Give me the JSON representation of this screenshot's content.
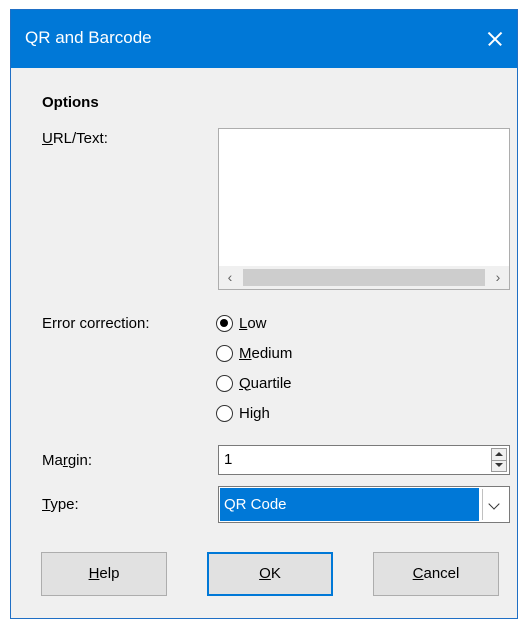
{
  "dialog": {
    "title": "QR and Barcode",
    "options_heading": "Options",
    "url_text": {
      "label_mnemonic": "U",
      "label_rest": "RL/Text:",
      "value": "",
      "scroll_left": "‹",
      "scroll_right": "›"
    },
    "error_correction": {
      "label": "Error correction:",
      "selected": "Low",
      "options": [
        {
          "mnemonic": "L",
          "rest": "ow"
        },
        {
          "mnemonic": "M",
          "rest": "edium"
        },
        {
          "mnemonic": "Q",
          "rest": "uartile"
        },
        {
          "pre": "Hi",
          "mnemonic": "g",
          "rest": "h"
        }
      ]
    },
    "margin": {
      "pre": "Ma",
      "mnemonic": "r",
      "rest": "gin:",
      "value": "1"
    },
    "type": {
      "mnemonic": "T",
      "rest": "ype:",
      "value": "QR Code"
    },
    "buttons": {
      "help": {
        "mnemonic": "H",
        "rest": "elp"
      },
      "ok": {
        "mnemonic": "O",
        "rest": "K"
      },
      "cancel": {
        "mnemonic": "C",
        "rest": "ancel"
      }
    },
    "colors": {
      "titlebar": "#0078d7",
      "selection": "#0078d7",
      "dialog_bg": "#f0f0f0"
    }
  }
}
